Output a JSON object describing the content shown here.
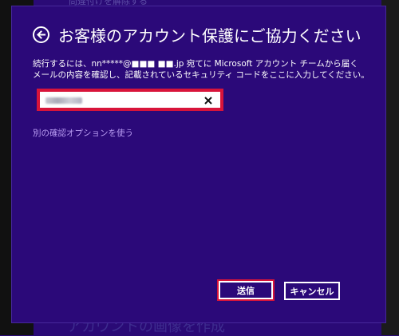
{
  "background": {
    "top_text": "問違付けを解除する",
    "bottom_text": "アカウントの画像を作成"
  },
  "dialog": {
    "back_icon": "back-arrow-circle-icon",
    "title": "お客様のアカウント保護にご協力ください",
    "description_line1": "続行するには、nn*****@■■■ ■■.jp 宛てに Microsoft アカウント チームから届く",
    "description_line2": "メールの内容を確認し、記載されているセキュリティ コードをここに入力してください。",
    "code_input": {
      "value": "",
      "clear_icon": "close-icon"
    },
    "alt_option_link": "別の確認オプションを使う",
    "send_button": "送信",
    "cancel_button": "キャンセル"
  },
  "colors": {
    "background": "#2a0a76",
    "highlight": "#d8143a",
    "link": "#b89cf2"
  }
}
